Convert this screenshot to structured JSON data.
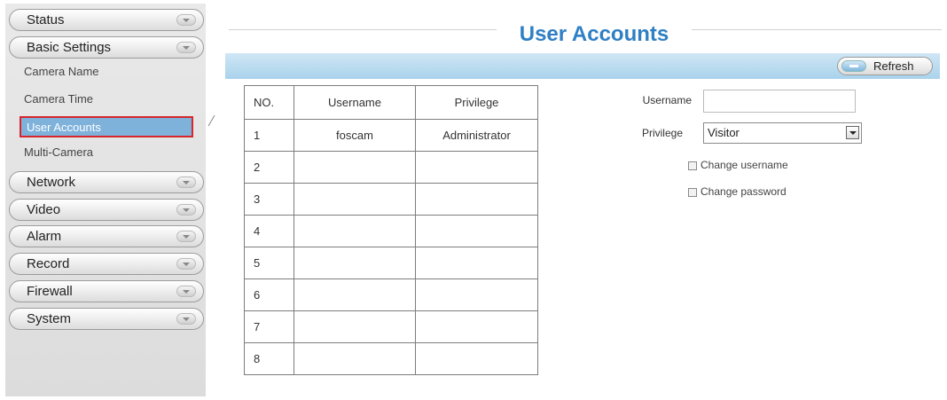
{
  "page": {
    "title": "User Accounts"
  },
  "toolbar": {
    "refresh_label": "Refresh"
  },
  "sidebar": {
    "items": [
      {
        "label": "Status"
      },
      {
        "label": "Basic Settings"
      },
      {
        "label": "Network"
      },
      {
        "label": "Video"
      },
      {
        "label": "Alarm"
      },
      {
        "label": "Record"
      },
      {
        "label": "Firewall"
      },
      {
        "label": "System"
      }
    ],
    "sub_items": [
      {
        "label": "Camera Name"
      },
      {
        "label": "Camera Time"
      },
      {
        "label": "User Accounts",
        "active": true
      },
      {
        "label": "Multi-Camera"
      }
    ]
  },
  "table": {
    "headers": [
      "NO.",
      "Username",
      "Privilege"
    ],
    "rows": [
      {
        "no": "1",
        "username": "foscam",
        "privilege": "Administrator"
      },
      {
        "no": "2",
        "username": "",
        "privilege": ""
      },
      {
        "no": "3",
        "username": "",
        "privilege": ""
      },
      {
        "no": "4",
        "username": "",
        "privilege": ""
      },
      {
        "no": "5",
        "username": "",
        "privilege": ""
      },
      {
        "no": "6",
        "username": "",
        "privilege": ""
      },
      {
        "no": "7",
        "username": "",
        "privilege": ""
      },
      {
        "no": "8",
        "username": "",
        "privilege": ""
      }
    ]
  },
  "form": {
    "username_label": "Username",
    "username_value": "",
    "privilege_label": "Privilege",
    "privilege_value": "Visitor",
    "change_username_label": "Change username",
    "change_password_label": "Change password"
  },
  "colors": {
    "title": "#2f7fc4",
    "toolbar": "#a9d3ec",
    "active_item": "#7fb2db",
    "highlight_border": "#d6262c"
  }
}
